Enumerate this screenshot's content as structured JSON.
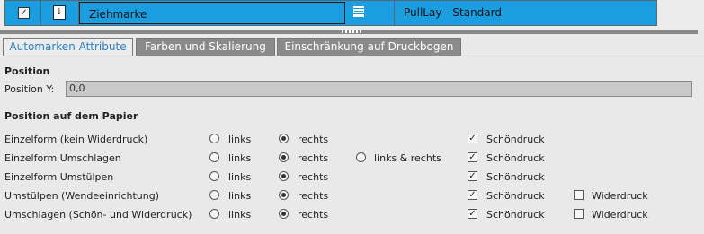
{
  "top_row": {
    "name": "Ziehmarke",
    "layout": "PullLay - Standard",
    "checked": true,
    "icons": [
      "pin-icon",
      "grid-icon"
    ]
  },
  "tabs": [
    {
      "label": "Automarken Attribute",
      "active": true
    },
    {
      "label": "Farben und Skalierung",
      "active": false
    },
    {
      "label": "Einschränkung auf Druckbogen",
      "active": false
    }
  ],
  "position": {
    "title": "Position",
    "y_label": "Position Y:",
    "y_value": "0,0"
  },
  "paper": {
    "title": "Position auf dem Papier",
    "rows": [
      {
        "label": "Einzelform (kein Widerdruck)",
        "links": "links",
        "rechts": "rechts",
        "selected": "rechts",
        "schoendruck": "Schöndruck"
      },
      {
        "label": "Einzelform Umschlagen",
        "links": "links",
        "rechts": "rechts",
        "both": "links & rechts",
        "selected": "rechts",
        "schoendruck": "Schöndruck"
      },
      {
        "label": "Einzelform Umstülpen",
        "links": "links",
        "rechts": "rechts",
        "selected": "rechts",
        "schoendruck": "Schöndruck"
      },
      {
        "label": "Umstülpen (Wendeeinrichtung)",
        "links": "links",
        "rechts": "rechts",
        "selected": "rechts",
        "schoendruck": "Schöndruck",
        "widerdruck": "Widerdruck"
      },
      {
        "label": "Umschlagen (Schön- und Widerdruck)",
        "links": "links",
        "rechts": "rechts",
        "selected": "rechts",
        "schoendruck": "Schöndruck",
        "widerdruck": "Widerdruck"
      }
    ]
  },
  "colors": {
    "selection": "#1b9ee0",
    "active_tab_text": "#2b7fc0",
    "inactive_tab": "#8a8a8a"
  }
}
